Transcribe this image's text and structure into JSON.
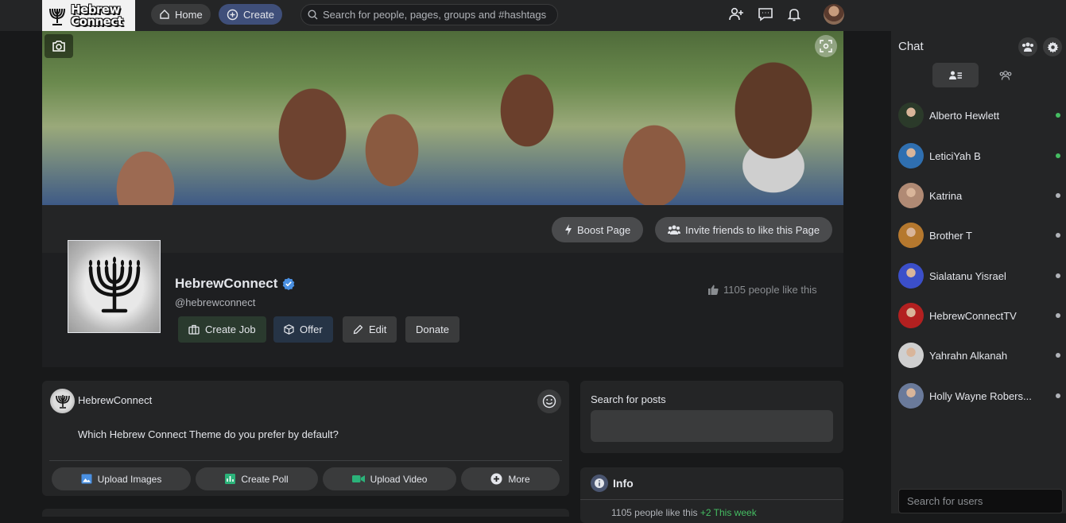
{
  "header": {
    "logo_line1": "Hebrew",
    "logo_line2": "Connect",
    "home_label": "Home",
    "create_label": "Create",
    "search_placeholder": "Search for people, pages, groups and #hashtags"
  },
  "page": {
    "boost_label": "Boost Page",
    "invite_label": "Invite friends to like this Page",
    "name": "HebrewConnect",
    "handle": "@hebrewconnect",
    "likes_text": "1105 people like this",
    "actions": {
      "create_job": "Create Job",
      "offer": "Offer",
      "edit": "Edit",
      "donate": "Donate"
    }
  },
  "composer": {
    "author": "HebrewConnect",
    "text": "Which Hebrew Connect Theme do you prefer by default?",
    "buttons": {
      "upload_images": "Upload Images",
      "create_poll": "Create Poll",
      "upload_video": "Upload Video",
      "more": "More"
    }
  },
  "sidebar": {
    "search_posts_title": "Search for posts",
    "info_title": "Info",
    "info_likes": "1105 people like this",
    "info_week": "+2 This week"
  },
  "chat": {
    "title": "Chat",
    "search_placeholder": "Search for users",
    "users": [
      {
        "name": "Alberto Hewlett",
        "online": true,
        "color": "#2b3a2a"
      },
      {
        "name": "LeticiYah B",
        "online": true,
        "color": "#2f6fb0"
      },
      {
        "name": "Katrina",
        "online": false,
        "color": "#b08a74"
      },
      {
        "name": "Brother T",
        "online": false,
        "color": "#b5782e"
      },
      {
        "name": "Sialatanu Yisrael",
        "online": false,
        "color": "#3b4fc9"
      },
      {
        "name": "HebrewConnectTV",
        "online": false,
        "color": "#b32020"
      },
      {
        "name": "Yahrahn Alkanah",
        "online": false,
        "color": "#cfcfcf"
      },
      {
        "name": "Holly Wayne Robers...",
        "online": false,
        "color": "#6a7a9a"
      }
    ]
  },
  "colors": {
    "online": "#45bd62",
    "offline": "#b0b3b8",
    "verified": "#4a90e2"
  }
}
